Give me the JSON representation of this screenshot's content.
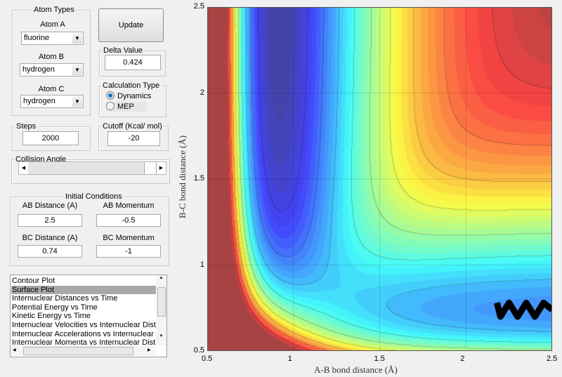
{
  "atom_types": {
    "title": "Atom Types",
    "atom_a_label": "Atom A",
    "atom_a": "fluorine",
    "atom_b_label": "Atom B",
    "atom_b": "hydrogen",
    "atom_c_label": "Atom C",
    "atom_c": "hydrogen"
  },
  "update_label": "Update",
  "delta": {
    "title": "Delta Value",
    "value": "0.424"
  },
  "calc": {
    "title": "Calculation Type",
    "options": [
      "Dynamics",
      "MEP"
    ],
    "selected": "Dynamics"
  },
  "steps": {
    "title": "Steps",
    "value": "2000"
  },
  "cutoff": {
    "title": "Cutoff (Kcal/ mol)",
    "value": "-20"
  },
  "collision": {
    "title": "Collision Angle",
    "slider_fraction": 1.0
  },
  "initial": {
    "title": "Initial Conditions",
    "ab_dist_label": "AB Distance (A)",
    "ab_dist": "2.5",
    "ab_mom_label": "AB Momentum",
    "ab_mom": "-0.5",
    "bc_dist_label": "BC Distance (A)",
    "bc_dist": "0.74",
    "bc_mom_label": "BC Momentum",
    "bc_mom": "-1"
  },
  "plot_list": {
    "items": [
      "Contour Plot",
      "Surface Plot",
      "Internuclear Distances vs Time",
      "Potential Energy vs Time",
      "Kinetic Energy vs Time",
      "Internuclear Velocities vs Internuclear Distance",
      "Internuclear Accelerations vs Internuclear Distance",
      "Internuclear Momenta vs Internuclear Distance"
    ],
    "selected": "Surface Plot"
  },
  "chart_data": {
    "type": "heatmap",
    "subtype": "filled contour",
    "colormap": "jet",
    "xlabel": "A-B bond distance (Å)",
    "ylabel": "B-C bond distance (Å)",
    "xlim": [
      0.5,
      2.5
    ],
    "ylim": [
      0.5,
      2.5
    ],
    "xticks": [
      "0.5",
      "1",
      "1.5",
      "2",
      "2.5"
    ],
    "yticks": [
      "0.5",
      "1",
      "1.5",
      "2",
      "2.5"
    ],
    "grid": true,
    "trajectory_color": "#000000",
    "trajectory": {
      "x": [
        2.5,
        2.45,
        2.4,
        2.35,
        2.3,
        2.25,
        2.2,
        2.18
      ],
      "y": [
        0.74,
        0.78,
        0.7,
        0.78,
        0.7,
        0.78,
        0.7,
        0.78
      ]
    }
  }
}
